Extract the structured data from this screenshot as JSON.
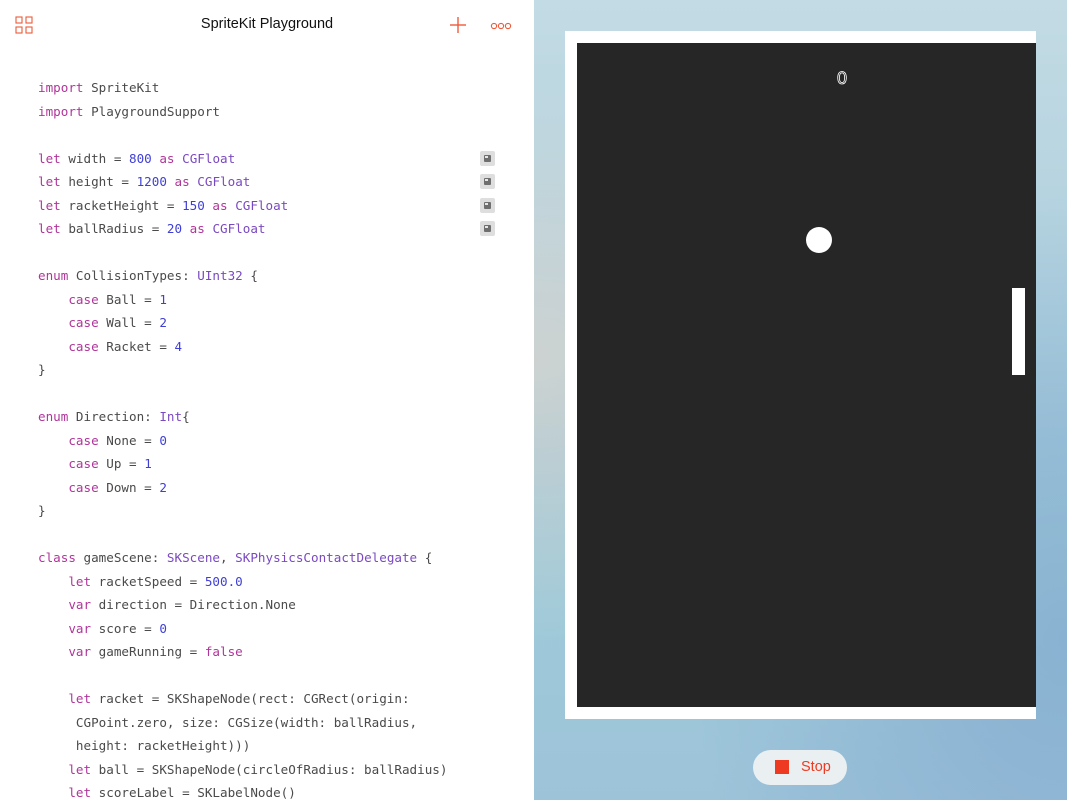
{
  "app": {
    "title": "SpriteKit Playground",
    "accent_color": "#ef5a3a",
    "icons": {
      "left": "grid-icon",
      "add": "plus-icon",
      "more": "more-icon"
    }
  },
  "code_lines": [
    [
      [
        "kw",
        "import"
      ],
      [
        "pl",
        " SpriteKit"
      ]
    ],
    [
      [
        "kw",
        "import"
      ],
      [
        "pl",
        " PlaygroundSupport"
      ]
    ],
    [],
    [
      [
        "kw",
        "let"
      ],
      [
        "pl",
        " width = "
      ],
      [
        "num",
        "800"
      ],
      [
        "pl",
        " "
      ],
      [
        "kw",
        "as"
      ],
      [
        "pl",
        " "
      ],
      [
        "ty",
        "CGFloat"
      ]
    ],
    [
      [
        "kw",
        "let"
      ],
      [
        "pl",
        " height = "
      ],
      [
        "num",
        "1200"
      ],
      [
        "pl",
        " "
      ],
      [
        "kw",
        "as"
      ],
      [
        "pl",
        " "
      ],
      [
        "ty",
        "CGFloat"
      ]
    ],
    [
      [
        "kw",
        "let"
      ],
      [
        "pl",
        " racketHeight = "
      ],
      [
        "num",
        "150"
      ],
      [
        "pl",
        " "
      ],
      [
        "kw",
        "as"
      ],
      [
        "pl",
        " "
      ],
      [
        "ty",
        "CGFloat"
      ]
    ],
    [
      [
        "kw",
        "let"
      ],
      [
        "pl",
        " ballRadius = "
      ],
      [
        "num",
        "20"
      ],
      [
        "pl",
        " "
      ],
      [
        "kw",
        "as"
      ],
      [
        "pl",
        " "
      ],
      [
        "ty",
        "CGFloat"
      ]
    ],
    [],
    [
      [
        "kw",
        "enum"
      ],
      [
        "pl",
        " CollisionTypes: "
      ],
      [
        "ty",
        "UInt32"
      ],
      [
        "pl",
        " {"
      ]
    ],
    [
      [
        "pl",
        "    "
      ],
      [
        "kw",
        "case"
      ],
      [
        "pl",
        " Ball = "
      ],
      [
        "num",
        "1"
      ]
    ],
    [
      [
        "pl",
        "    "
      ],
      [
        "kw",
        "case"
      ],
      [
        "pl",
        " Wall = "
      ],
      [
        "num",
        "2"
      ]
    ],
    [
      [
        "pl",
        "    "
      ],
      [
        "kw",
        "case"
      ],
      [
        "pl",
        " Racket = "
      ],
      [
        "num",
        "4"
      ]
    ],
    [
      [
        "pl",
        "}"
      ]
    ],
    [],
    [
      [
        "kw",
        "enum"
      ],
      [
        "pl",
        " Direction: "
      ],
      [
        "ty",
        "Int"
      ],
      [
        "pl",
        "{"
      ]
    ],
    [
      [
        "pl",
        "    "
      ],
      [
        "kw",
        "case"
      ],
      [
        "pl",
        " None = "
      ],
      [
        "num",
        "0"
      ]
    ],
    [
      [
        "pl",
        "    "
      ],
      [
        "kw",
        "case"
      ],
      [
        "pl",
        " Up = "
      ],
      [
        "num",
        "1"
      ]
    ],
    [
      [
        "pl",
        "    "
      ],
      [
        "kw",
        "case"
      ],
      [
        "pl",
        " Down = "
      ],
      [
        "num",
        "2"
      ]
    ],
    [
      [
        "pl",
        "}"
      ]
    ],
    [],
    [
      [
        "kw",
        "class"
      ],
      [
        "pl",
        " gameScene: "
      ],
      [
        "ty",
        "SKScene"
      ],
      [
        "pl",
        ", "
      ],
      [
        "ty",
        "SKPhysicsContactDelegate"
      ],
      [
        "pl",
        " {"
      ]
    ],
    [
      [
        "pl",
        "    "
      ],
      [
        "kw",
        "let"
      ],
      [
        "pl",
        " racketSpeed = "
      ],
      [
        "num",
        "500.0"
      ]
    ],
    [
      [
        "pl",
        "    "
      ],
      [
        "kw",
        "var"
      ],
      [
        "pl",
        " direction = Direction.None"
      ]
    ],
    [
      [
        "pl",
        "    "
      ],
      [
        "kw",
        "var"
      ],
      [
        "pl",
        " score = "
      ],
      [
        "num",
        "0"
      ]
    ],
    [
      [
        "pl",
        "    "
      ],
      [
        "kw",
        "var"
      ],
      [
        "pl",
        " gameRunning = "
      ],
      [
        "kw",
        "false"
      ]
    ],
    [],
    [
      [
        "pl",
        "    "
      ],
      [
        "kw",
        "let"
      ],
      [
        "pl",
        " racket = SKShapeNode(rect: CGRect(origin:"
      ]
    ],
    [
      [
        "pl",
        "     CGPoint.zero, size: CGSize(width: ballRadius,"
      ]
    ],
    [
      [
        "pl",
        "     height: racketHeight)))"
      ]
    ],
    [
      [
        "pl",
        "    "
      ],
      [
        "kw",
        "let"
      ],
      [
        "pl",
        " ball = SKShapeNode(circleOfRadius: ballRadius)"
      ]
    ],
    [
      [
        "pl",
        "    "
      ],
      [
        "kw",
        "let"
      ],
      [
        "pl",
        " scoreLabel = SKLabelNode()"
      ]
    ]
  ],
  "result_viewer_lines": [
    3,
    4,
    5,
    6
  ],
  "result_viewer_icon": "result-viewer-icon",
  "syntax_colors": {
    "keyword": "#b0359a",
    "type": "#7a49c1",
    "number": "#3f3fd6",
    "plain": "#4a4a4a"
  },
  "live_view": {
    "score": "0",
    "background": "#262626",
    "stop_button": {
      "label": "Stop",
      "icon": "stop-icon",
      "color": "#ef3a22"
    }
  }
}
